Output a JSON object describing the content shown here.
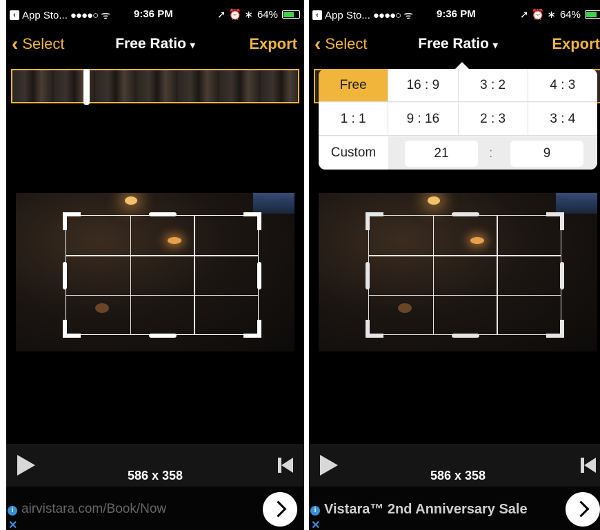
{
  "status_bar": {
    "back_app": "App Sto...",
    "signal": "●●●●○",
    "wifi": "ᯤ",
    "time": "9:36 PM",
    "icons": "➚ ⏰ ∗",
    "battery_text": "64%",
    "battery_level": 0.64
  },
  "nav": {
    "back_label": "Select",
    "title": "Free Ratio",
    "title_caret": "▾",
    "export_label": "Export"
  },
  "toolbar": {
    "dimensions": "586 x 358"
  },
  "ads": {
    "left_text": "airvistara.com/Book/Now",
    "right_text": "Vistara™ 2nd Anniversary Sale"
  },
  "ratio_popup": {
    "row1": [
      "Free",
      "16 : 9",
      "3 : 2",
      "4 : 3"
    ],
    "row2": [
      "1 : 1",
      "9 : 16",
      "2 : 3",
      "3 : 4"
    ],
    "custom_label": "Custom",
    "custom_width": "21",
    "custom_separator": ":",
    "custom_height": "9",
    "selected": "Free"
  },
  "colors": {
    "accent": "#f0b53a",
    "background": "#000000"
  }
}
